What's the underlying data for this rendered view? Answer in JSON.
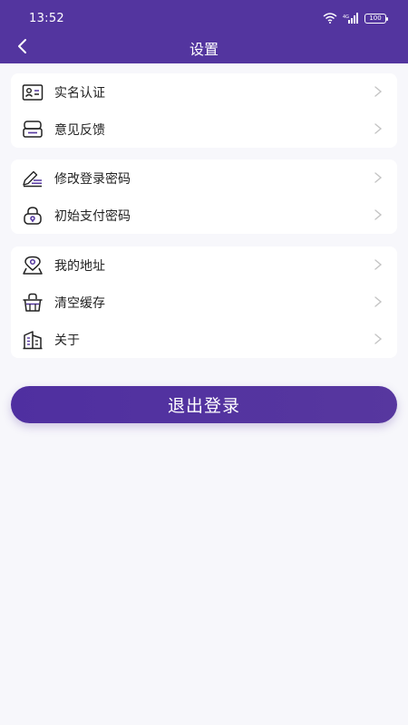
{
  "status_bar": {
    "time": "13:52",
    "battery": "100",
    "icons": [
      "wifi-icon",
      "signal-icon",
      "battery-icon"
    ]
  },
  "nav": {
    "title": "设置",
    "back_icon": "chevron-left-icon"
  },
  "groups": [
    {
      "items": [
        {
          "label": "实名认证",
          "icon": "id-card-icon"
        },
        {
          "label": "意见反馈",
          "icon": "feedback-box-icon"
        }
      ]
    },
    {
      "items": [
        {
          "label": "修改登录密码",
          "icon": "edit-pen-icon"
        },
        {
          "label": "初始支付密码",
          "icon": "lock-icon"
        }
      ]
    },
    {
      "items": [
        {
          "label": "我的地址",
          "icon": "location-icon"
        },
        {
          "label": "清空缓存",
          "icon": "basket-icon"
        },
        {
          "label": "关于",
          "icon": "building-icon"
        }
      ]
    }
  ],
  "logout_label": "退出登录",
  "colors": {
    "primary": "#53359f",
    "background": "#f7f7fb",
    "chevron": "#c4c4c4",
    "text": "#222222"
  }
}
